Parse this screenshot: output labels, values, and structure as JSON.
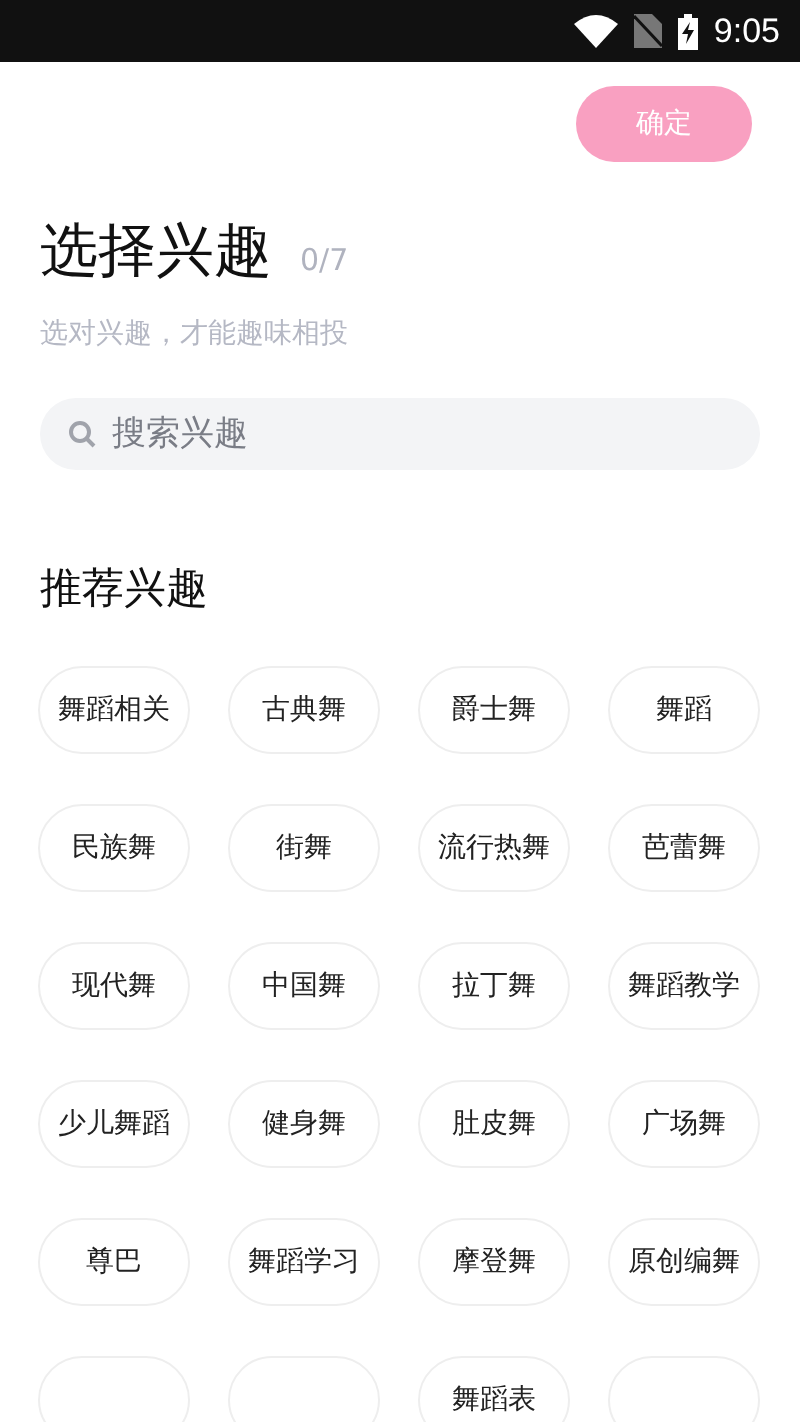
{
  "status_bar": {
    "time": "9:05"
  },
  "confirm_button": {
    "label": "确定",
    "disabled": true
  },
  "header": {
    "title": "选择兴趣",
    "count": "0/7",
    "subtitle": "选对兴趣，才能趣味相投"
  },
  "search": {
    "placeholder": "搜索兴趣"
  },
  "section_title": "推荐兴趣",
  "interests": [
    {
      "label": "舞蹈相关",
      "selected": false
    },
    {
      "label": "古典舞",
      "selected": false
    },
    {
      "label": "爵士舞",
      "selected": false
    },
    {
      "label": "舞蹈",
      "selected": false
    },
    {
      "label": "民族舞",
      "selected": false
    },
    {
      "label": "街舞",
      "selected": false
    },
    {
      "label": "流行热舞",
      "selected": false
    },
    {
      "label": "芭蕾舞",
      "selected": false
    },
    {
      "label": "现代舞",
      "selected": false
    },
    {
      "label": "中国舞",
      "selected": false
    },
    {
      "label": "拉丁舞",
      "selected": false
    },
    {
      "label": "舞蹈教学",
      "selected": false
    },
    {
      "label": "少儿舞蹈",
      "selected": false
    },
    {
      "label": "健身舞",
      "selected": false
    },
    {
      "label": "肚皮舞",
      "selected": false
    },
    {
      "label": "广场舞",
      "selected": false
    },
    {
      "label": "尊巴",
      "selected": false
    },
    {
      "label": "舞蹈学习",
      "selected": false
    },
    {
      "label": "摩登舞",
      "selected": false
    },
    {
      "label": "原创编舞",
      "selected": false
    },
    {
      "selected": false
    },
    {
      "selected": false
    },
    {
      "label": "舞蹈表",
      "selected": false
    },
    {
      "selected": false
    }
  ]
}
